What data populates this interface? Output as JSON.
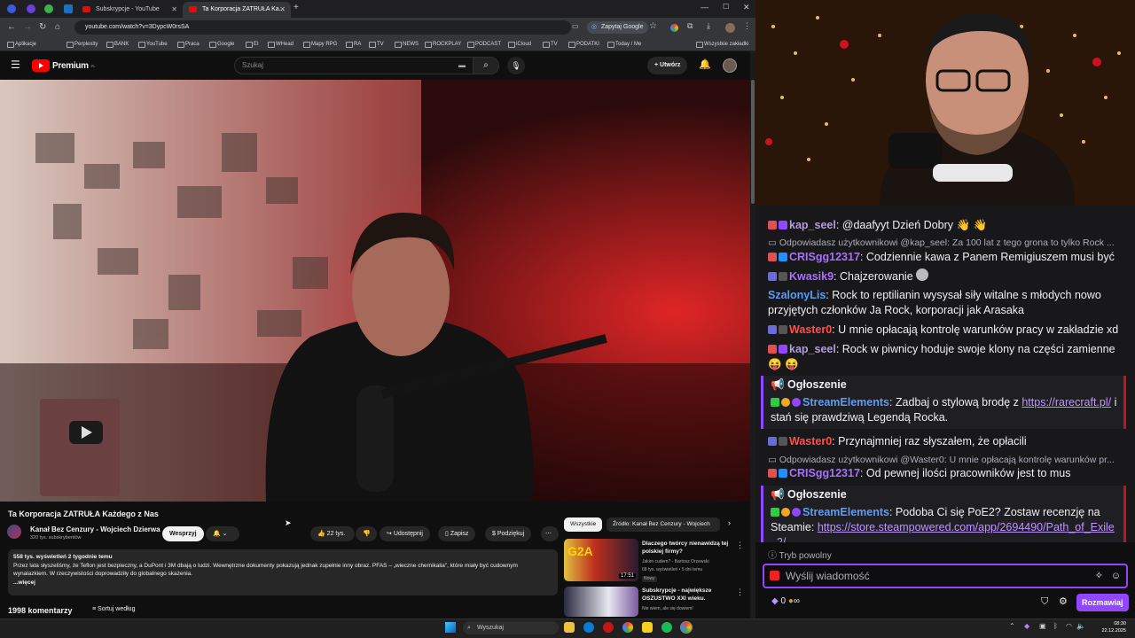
{
  "browser": {
    "tabs": [
      {
        "label": "Subskrypcje - YouTube"
      },
      {
        "label": "Ta Korporacja ZATRUŁA Ka..."
      }
    ],
    "url": "youtube.com/watch?v=3DypcW0rsSA",
    "ask_google": "Zapytaj Google",
    "bookmarks": [
      "Aplikacje",
      "Perplexity",
      "BANK",
      "YouTube",
      "Praca",
      "Google",
      "EI",
      "WHead",
      "Mapy RPG",
      "RA",
      "TV",
      "NEWS",
      "ROCKPLAY",
      "PODCAST",
      "iCloud",
      "TV",
      "PODATKI",
      "Today / Me"
    ],
    "all_bookmarks": "Wszystkie zakładki"
  },
  "youtube": {
    "logo": "Premium",
    "logo_region": "PL",
    "search_placeholder": "Szukaj",
    "create_label": "Utwórz",
    "video_title": "Ta Korporacja ZATRUŁA Każdego z Nas",
    "channel_name": "Kanał Bez Cenzury - Wojciech Dzierwa",
    "subscribers": "320 tys. subskrybentów",
    "support_label": "Wesprzyj",
    "likes": "22 tys.",
    "share_label": "Udostępnij",
    "save_label": "Zapisz",
    "thanks_label": "Podziękuj",
    "views_date": "558 tys. wyświetleń  2 tygodnie temu",
    "description": "Przez lata słyszeliśmy, że Teflon jest bezpieczny, a DuPont i 3M dbają o ludzi. Wewnętrzne dokumenty pokazują jednak zupełnie inny obraz. PFAS – „wieczne chemikalia”, które miały być cudownym wynalazkiem. W rzeczywistości doprowadziły do globalnego skażenia.",
    "more_label": "...więcej",
    "comments_count": "1998 komentarzy",
    "sort_label": "Sortuj według",
    "chips": [
      "Wszystkie",
      "Źródło: Kanał Bez Cenzury - Wojciech"
    ],
    "recommendations": [
      {
        "title": "Dlaczego twórcy nienawidzą tej polskiej firmy?",
        "channel": "Jakim cudem? - Bartosz Orzewski",
        "meta": "68 tys. wyświetleń • 5 dni temu",
        "badge": "Nowy",
        "duration": "17:51"
      },
      {
        "title": "Subskrypcje - największe OSZUSTWO XXI wieku.",
        "channel": "Nie wiem, ale się dowiem!"
      }
    ]
  },
  "chat": {
    "messages": [
      {
        "user": "kap_seel",
        "color": "#b39ddb",
        "text": ": @daafyyt Dzień Dobry 👋 👋"
      },
      {
        "reply": "Odpowiadasz użytkownikowi @kap_seel: Za 100 lat z tego grona to tylko Rock ..."
      },
      {
        "user": "CRISgg12317",
        "color": "#a970ff",
        "text": ": Codziennie kawa z Panem Remigiuszem musi być"
      },
      {
        "user": "Kwasik9",
        "color": "#a970ff",
        "text": ": Chajzerowanie"
      },
      {
        "user": "SzalonyLis",
        "color": "#5c9cf5",
        "text": ": Rock to reptilianin wysysał siły witalne s młodych nowo przyjętych członków Ja Rock, korporacji jak Arasaka"
      },
      {
        "user": "Waster0",
        "color": "#ff4f4f",
        "text": ": U mnie opłacają kontrolę warunków pracy w zakładzie xd"
      },
      {
        "user": "kap_seel",
        "color": "#b39ddb",
        "text": ": Rock w piwnicy hoduje swoje klony na części zamienne 😝 😝"
      },
      {
        "announcement": "Ogłoszenie",
        "user": "StreamElements",
        "color": "#5c9cf5",
        "text": ": Zadbaj o stylową brodę z ",
        "link": "https://rarecraft.pl/",
        "text2": " i stań się prawdziwą Legendą Rocka."
      },
      {
        "user": "Waster0",
        "color": "#ff4f4f",
        "text": ": Przynajmniej raz słyszałem, że opłacili"
      },
      {
        "reply": "Odpowiadasz użytkownikowi @Waster0: U mnie opłacają kontrolę warunków pr..."
      },
      {
        "user": "CRISgg12317",
        "color": "#a970ff",
        "text": ": Od pewnej ilości pracowników jest to mus"
      },
      {
        "announcement": "Ogłoszenie",
        "user": "StreamElements",
        "color": "#5c9cf5",
        "text": ": Podoba Ci się PoE2? Zostaw recenzję na Steamie: ",
        "link": "https://store.steampowered.com/app/2694490/Path_of_Exile_2/"
      }
    ],
    "slow_mode": "Tryb powolny",
    "input_placeholder": "Wyślij wiadomość",
    "points": "0",
    "send_label": "Rozmawiaj"
  },
  "taskbar": {
    "search_placeholder": "Wyszukaj",
    "time": "08:30",
    "date": "22.12.2025"
  }
}
